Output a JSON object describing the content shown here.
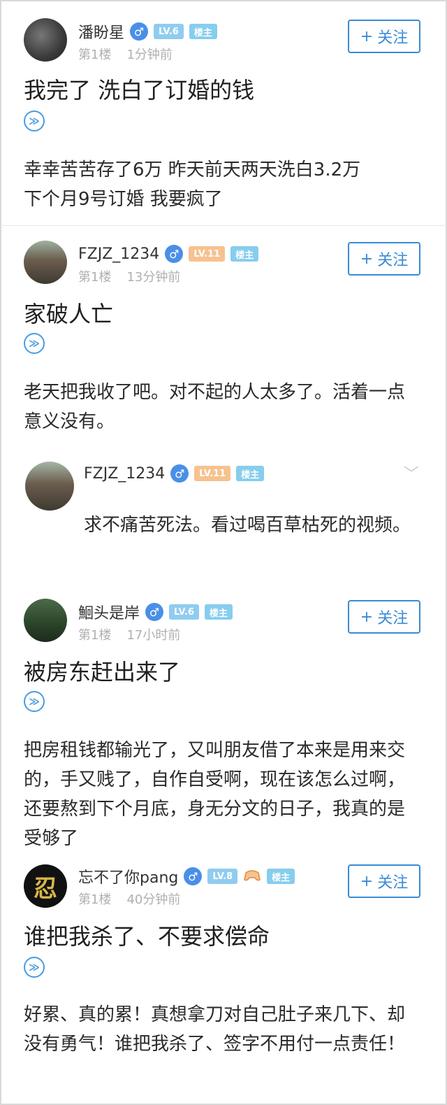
{
  "posts": [
    {
      "username": "潘盼星",
      "gender_icon": "♂",
      "level": "LV.6",
      "owner_badge": "楼主",
      "floor": "第1楼",
      "time": "1分钟前",
      "follow_label": "关注",
      "title": "我完了  洗白了订婚的钱",
      "body": "幸幸苦苦存了6万  昨天前天两天洗白3.2万\n下个月9号订婚  我要疯了"
    },
    {
      "username": "FZJZ_1234",
      "gender_icon": "♂",
      "level": "LV.11",
      "owner_badge": "楼主",
      "floor": "第1楼",
      "time": "13分钟前",
      "follow_label": "关注",
      "title": "家破人亡",
      "body": "老天把我收了吧。对不起的人太多了。活着一点意义没有。"
    },
    {
      "username": "鮰头是岸",
      "gender_icon": "♂",
      "level": "LV.6",
      "owner_badge": "楼主",
      "floor": "第1楼",
      "time": "17小时前",
      "follow_label": "关注",
      "title": "被房东赶出来了",
      "body": "把房租钱都输光了，又叫朋友借了本来是用来交的，手又贱了，自作自受啊，现在该怎么过啊，还要熬到下个月底，身无分文的日子，我真的是受够了"
    },
    {
      "username": "忘不了你pang",
      "gender_icon": "♂",
      "level": "LV.8",
      "owner_badge": "楼主",
      "floor": "第1楼",
      "time": "40分钟前",
      "follow_label": "关注",
      "title": "谁把我杀了、不要求偿命",
      "body": "好累、真的累！真想拿刀对自己肚子来几下、却没有勇气！谁把我杀了、签字不用付一点责任！"
    }
  ],
  "reply": {
    "username": "FZJZ_1234",
    "gender_icon": "♂",
    "level": "LV.11",
    "owner_badge": "楼主",
    "text": "求不痛苦死法。看过喝百草枯死的视频。"
  },
  "avatar_icon_text": "忍",
  "voice_icon": "≫",
  "plus_icon": "+",
  "chevron_icon": "﹀",
  "colors": {
    "accent": "#3a8ad6",
    "level_blue": "#90ccef",
    "level_orange": "#f6c28f",
    "meta_gray": "#b0b0b0"
  }
}
